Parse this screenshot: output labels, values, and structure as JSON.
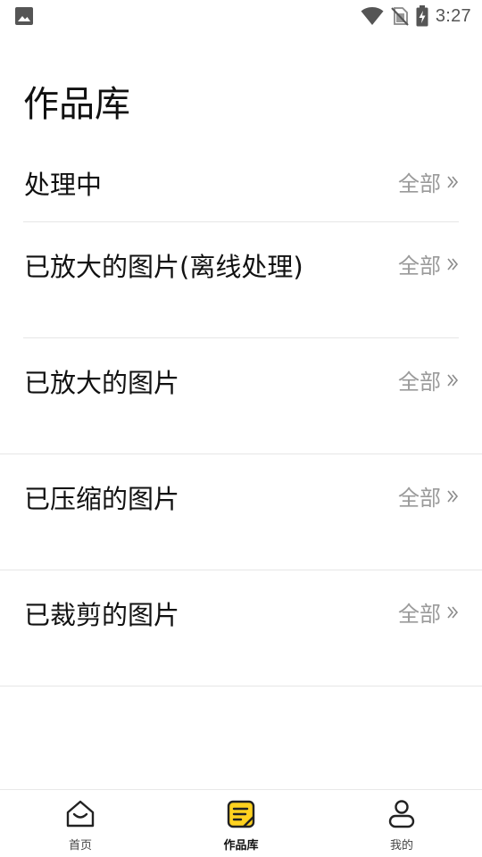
{
  "status_bar": {
    "time": "3:27",
    "icons": [
      "image-icon",
      "wifi-icon",
      "no-sim-icon",
      "battery-charging-icon"
    ]
  },
  "page": {
    "title": "作品库"
  },
  "sections": [
    {
      "title": "处理中",
      "all_label": "全部"
    },
    {
      "title": "已放大的图片(离线处理)",
      "all_label": "全部"
    },
    {
      "title": "已放大的图片",
      "all_label": "全部"
    },
    {
      "title": "已压缩的图片",
      "all_label": "全部"
    },
    {
      "title": "已裁剪的图片",
      "all_label": "全部"
    }
  ],
  "bottom_nav": {
    "items": [
      {
        "label": "首页",
        "icon": "home-icon",
        "active": false
      },
      {
        "label": "作品库",
        "icon": "gallery-note-icon",
        "active": true
      },
      {
        "label": "我的",
        "icon": "profile-icon",
        "active": false
      }
    ],
    "accent_color": "#FFD21F"
  }
}
